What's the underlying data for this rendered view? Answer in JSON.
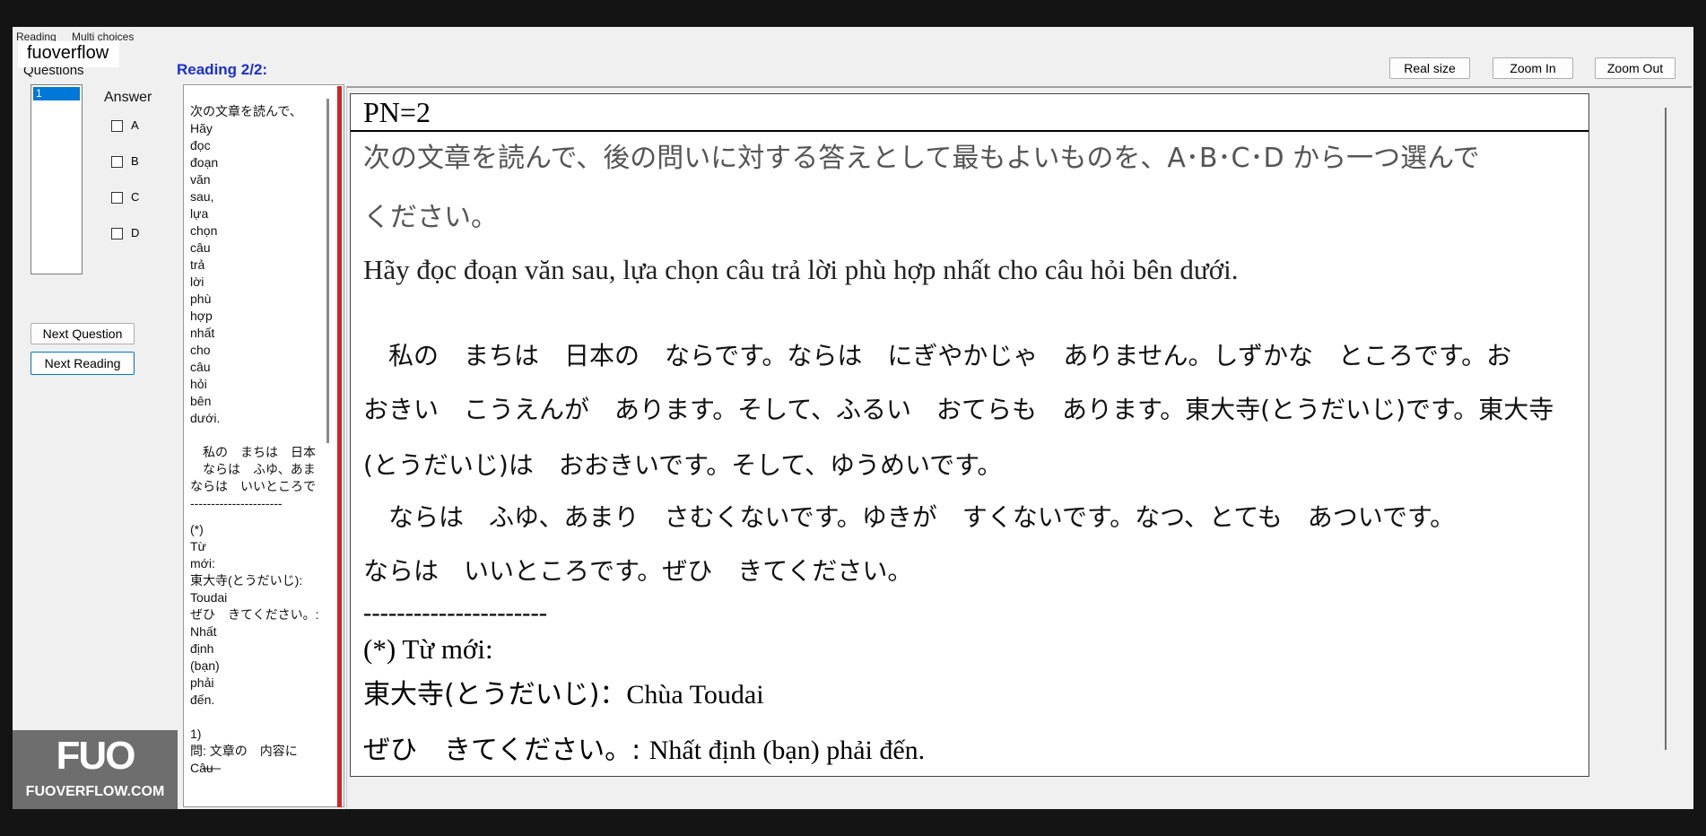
{
  "window": {
    "menu": [
      "Reading",
      "Multi choices"
    ]
  },
  "watermark_top": "fuoverflow",
  "watermark_bottom": {
    "logo": "FUO",
    "site": "FUOVERFLOW.COM"
  },
  "questions": {
    "label": "Questions",
    "items": [
      "1"
    ],
    "selected": "1"
  },
  "answer": {
    "label": "Answer",
    "options": [
      "A",
      "B",
      "C",
      "D"
    ]
  },
  "buttons": {
    "next_question": "Next Question",
    "next_reading": "Next Reading",
    "real_size": "Real size",
    "zoom_in": "Zoom In",
    "zoom_out": "Zoom Out"
  },
  "reading": {
    "title": "Reading 2/2:"
  },
  "left_text": {
    "words": [
      "次の文章を読んで、",
      "Hãy",
      "đọc",
      "đoạn",
      "văn",
      "sau,",
      "lựa",
      "chọn",
      "câu",
      "trả",
      "lời",
      "phù",
      "hợp",
      "nhất",
      "cho",
      "câu",
      "hỏi",
      "bên",
      "dưới."
    ],
    "passage": [
      "　私の　まちは　日本",
      "　ならは　ふゆ、あま",
      "ならは　いいところで"
    ],
    "divider": "----------------------",
    "vocab": [
      "(*)",
      "Từ",
      "mới:",
      "東大寺(とうだいじ):",
      "Toudai",
      "ぜひ　きてください。:",
      "Nhất",
      "định",
      "(bạn)",
      "phải",
      "đến."
    ],
    "question": [
      "1)",
      "問: 文章の　内容に",
      "Câu"
    ]
  },
  "doc": {
    "header": "PN=2",
    "instr_jp_1": "次の文章を読んで、後の問いに対する答えとして最もよいものを、A･B･C･D から一つ選んで",
    "instr_jp_2": "ください。",
    "instr_vi": "Hãy đọc đoạn văn sau, lựa chọn câu trả lời phù hợp nhất cho câu hỏi bên dưới.",
    "p1": "　私の　まちは　日本の　ならです。ならは　にぎやかじゃ　ありません。しずかな　ところです。お",
    "p2": "おきい　こうえんが　あります。そして、ふるい　おてらも　あります。東大寺(とうだいじ)です。東大寺",
    "p3": "(とうだいじ)は　おおきいです。そして、ゆうめいです。",
    "p4": "　ならは　ふゆ、あまり　さむくないです。ゆきが　すくないです。なつ、とても　あついです。",
    "p5": "ならは　いいところです。ぜひ　きてください。",
    "divider": "----------------------",
    "vocab_title": "(*) Từ mới:",
    "vocab1_jp": "東大寺(とうだいじ)：",
    "vocab1_vi": "Chùa Toudai",
    "vocab2_jp": "ぜひ　きてください。: ",
    "vocab2_vi": "Nhất định (bạn) phải đến."
  },
  "colors": {
    "reading_title": "#1a2fd6",
    "accent_red": "#d62424"
  }
}
